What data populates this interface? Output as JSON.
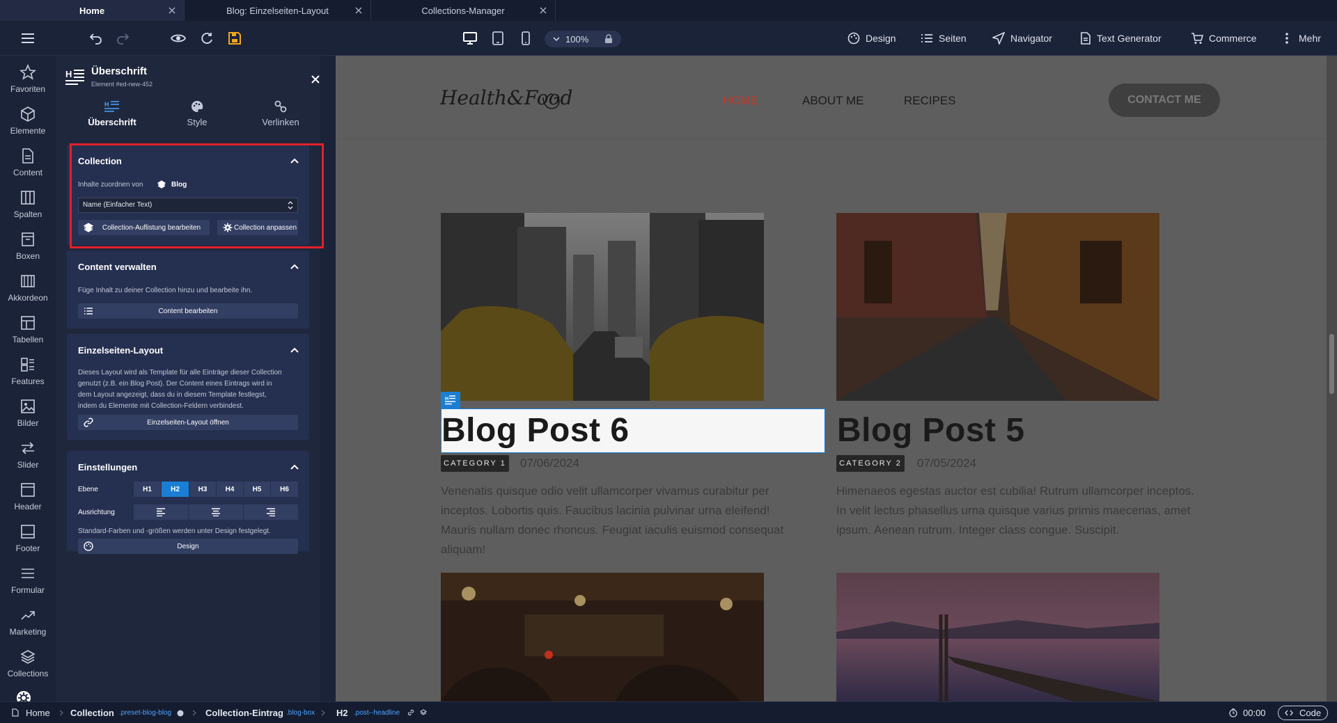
{
  "tabs": [
    {
      "label": "Home",
      "active": true
    },
    {
      "label": "Blog: Einzelseiten-Layout",
      "active": false
    },
    {
      "label": "Collections-Manager",
      "active": false
    }
  ],
  "toolbar": {
    "zoom": "100%",
    "menu": [
      "Design",
      "Seiten",
      "Navigator",
      "Text Generator",
      "Commerce",
      "Mehr"
    ]
  },
  "rail": [
    "Favoriten",
    "Elemente",
    "Content",
    "Spalten",
    "Boxen",
    "Akkordeon",
    "Tabellen",
    "Features",
    "Bilder",
    "Slider",
    "Header",
    "Footer",
    "Formular",
    "Marketing",
    "Collections"
  ],
  "panel": {
    "title": "Überschrift",
    "subtitle": "Element #ed-new-452",
    "tabs": [
      "Überschrift",
      "Style",
      "Verlinken"
    ],
    "collection": {
      "title": "Collection",
      "assign_label": "Inhalte zuordnen von",
      "assign_value": "Blog",
      "select_value": "Name (Einfacher Text)",
      "btn_edit_list": "Collection-Auflistung bearbeiten",
      "btn_customize": "Collection anpassen"
    },
    "content": {
      "title": "Content verwalten",
      "text": "Füge Inhalt zu deiner Collection hinzu und bearbeite ihn.",
      "button": "Content bearbeiten"
    },
    "layout": {
      "title": "Einzelseiten-Layout",
      "lines": [
        "Dieses Layout wird als Template für alle Einträge dieser Collection",
        "genutzt (z.B. ein Blog Post). Der Content eines Eintrags wird in",
        "dem Layout angezeigt, dass du in diesem Template festlegst,",
        "indem du Elemente mit Collection-Feldern verbindest."
      ],
      "button": "Einzelseiten-Layout öffnen"
    },
    "settings": {
      "title": "Einstellungen",
      "level_label": "Ebene",
      "levels": [
        "H1",
        "H2",
        "H3",
        "H4",
        "H5",
        "H6"
      ],
      "active_level": "H2",
      "align_label": "Ausrichtung",
      "note": "Standard-Farben und -größen werden unter Design festgelegt.",
      "button": "Design"
    }
  },
  "site": {
    "logo": "Health&Food",
    "nav": [
      "HOME",
      "ABOUT ME",
      "RECIPES"
    ],
    "cta": "CONTACT ME",
    "colors": {
      "active_nav": "#c0392b",
      "selection": "#1a7fd4"
    },
    "posts": [
      {
        "title": "Blog Post 6",
        "category": "CATEGORY 1",
        "date": "07/06/2024",
        "excerpt": [
          "Venenatis quisque odio velit ullamcorper vivamus curabitur per",
          "inceptos. Lobortis quis. Faucibus lacinia pulvinar urna eleifend!",
          "Mauris nullam donec rhoncus. Feugiat iaculis euismod consequat",
          "aliquam!"
        ]
      },
      {
        "title": "Blog Post 5",
        "category": "CATEGORY 2",
        "date": "07/05/2024",
        "excerpt": [
          "Himenaeos egestas auctor est cubilia! Rutrum ullamcorper inceptos.",
          "In velit lectus phasellus urna quisque varius primis maecenas, amet",
          "ipsum. Aenean rutrum. Integer class congue. Suscipit."
        ]
      }
    ]
  },
  "bottombar": {
    "crumbs": [
      {
        "label": "Home",
        "cls": ""
      },
      {
        "label": "Collection",
        "cls": ".preset-blog-blog"
      },
      {
        "label": "Collection-Eintrag",
        "cls": ".blog-box"
      },
      {
        "label": "H2",
        "cls": ".post--headline"
      }
    ],
    "time": "00:00",
    "code": "Code"
  }
}
